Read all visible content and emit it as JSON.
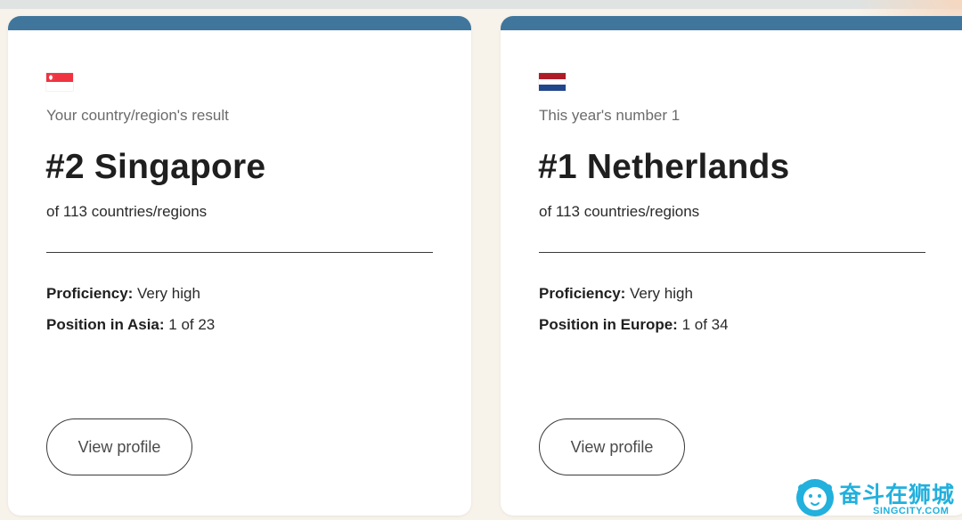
{
  "colors": {
    "card_bar": "#41769c",
    "page_background": "#f7f2ea",
    "watermark": "#22b0dd"
  },
  "cards": [
    {
      "flag": "singapore-flag",
      "flag_colors": [
        "#ef3340",
        "#ffffff"
      ],
      "subtitle": "Your country/region's result",
      "rank_title": "#2 Singapore",
      "rank_sub": "of 113 countries/regions",
      "proficiency_label": "Proficiency:",
      "proficiency_value": " Very high",
      "position_label": "Position in Asia:",
      "position_value": " 1 of 23",
      "button_label": "View profile"
    },
    {
      "flag": "netherlands-flag",
      "flag_colors": [
        "#ae1c28",
        "#ffffff",
        "#21468b"
      ],
      "subtitle": "This year's number 1",
      "rank_title": "#1 Netherlands",
      "rank_sub": "of 113 countries/regions",
      "proficiency_label": "Proficiency:",
      "proficiency_value": " Very high",
      "position_label": "Position in Europe:",
      "position_value": " 1 of 34",
      "button_label": "View profile"
    }
  ],
  "watermark": {
    "icon": "lion-logo-icon",
    "text": "奋斗在狮城",
    "url": "SINGCITY.COM"
  }
}
